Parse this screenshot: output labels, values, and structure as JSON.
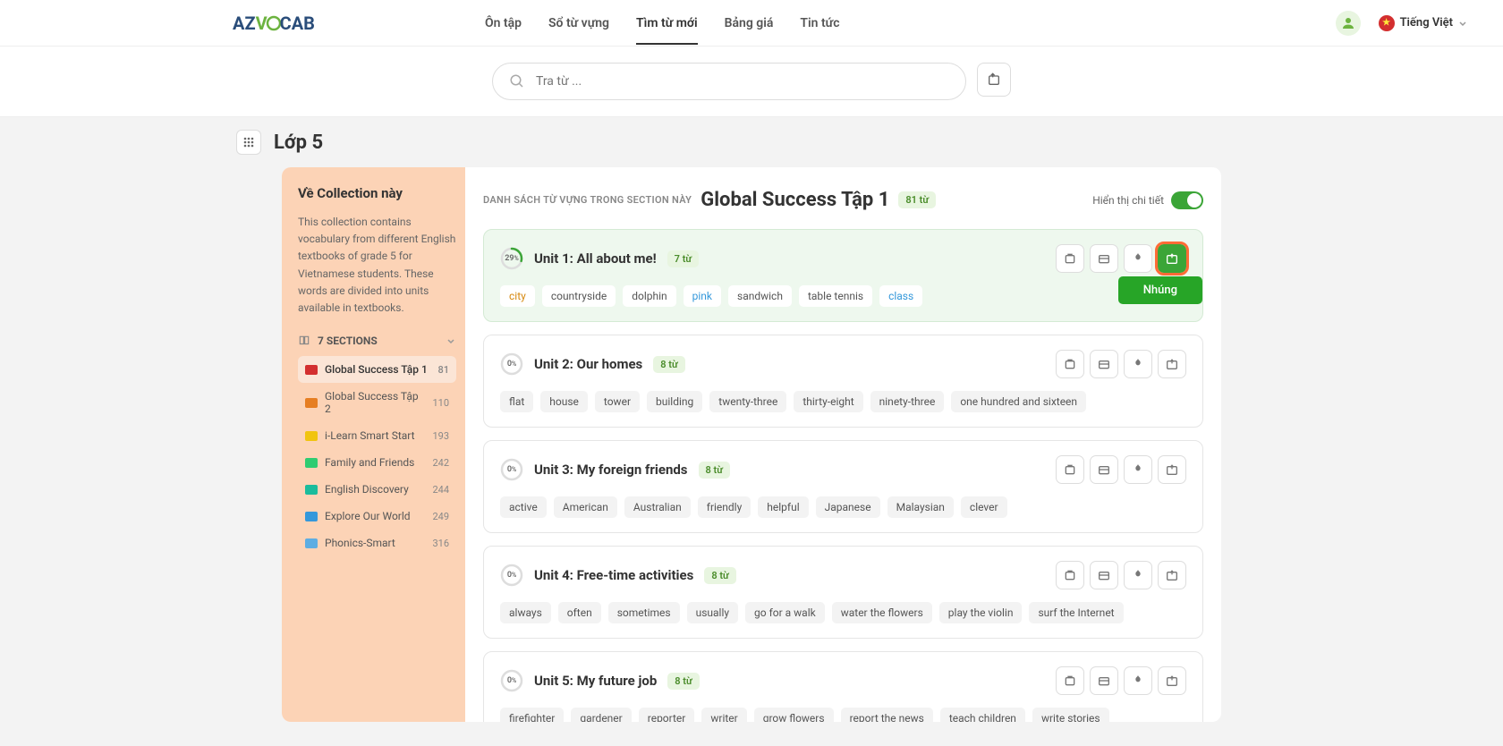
{
  "header": {
    "logo_az": "AZ",
    "logo_v": "V",
    "logo_ocab": "CAB",
    "nav": [
      "Ôn tập",
      "Sổ từ vựng",
      "Tìm từ mới",
      "Bảng giá",
      "Tin tức"
    ],
    "nav_active": 2,
    "lang_label": "Tiếng Việt"
  },
  "search": {
    "placeholder": "Tra từ ..."
  },
  "breadcrumb": "Lớp 5",
  "sidebar": {
    "title": "Về Collection này",
    "desc": "This collection contains vocabulary from different English textbooks of grade 5 for Vietnamese students. These words are divided into units available in textbooks.",
    "sections_label": "7 SECTIONS",
    "items": [
      {
        "name": "Global Success Tập 1",
        "count": "81",
        "color": "#d32f2f",
        "active": true
      },
      {
        "name": "Global Success Tập 2",
        "count": "110",
        "color": "#e67e22",
        "active": false
      },
      {
        "name": "i-Learn Smart Start",
        "count": "193",
        "color": "#f1c40f",
        "active": false
      },
      {
        "name": "Family and Friends",
        "count": "242",
        "color": "#2ecc71",
        "active": false
      },
      {
        "name": "English Discovery",
        "count": "244",
        "color": "#1abc9c",
        "active": false
      },
      {
        "name": "Explore Our World",
        "count": "249",
        "color": "#3498db",
        "active": false
      },
      {
        "name": "Phonics-Smart",
        "count": "316",
        "color": "#5dade2",
        "active": false
      }
    ]
  },
  "main": {
    "subtitle": "DANH SÁCH TỪ VỰNG TRONG SECTION NÀY",
    "title": "Global Success Tập 1",
    "badge": "81 từ",
    "toggle_label": "Hiển thị chi tiết",
    "tooltip": "Nhúng",
    "units": [
      {
        "progress": 29,
        "title": "Unit 1: All about me!",
        "count": "7 từ",
        "active": true,
        "tags": [
          {
            "t": "city",
            "c": "learned"
          },
          {
            "t": "countryside"
          },
          {
            "t": "dolphin"
          },
          {
            "t": "pink",
            "c": "blue"
          },
          {
            "t": "sandwich"
          },
          {
            "t": "table tennis"
          },
          {
            "t": "class",
            "c": "blue"
          }
        ]
      },
      {
        "progress": 0,
        "title": "Unit 2: Our homes",
        "count": "8 từ",
        "tags": [
          {
            "t": "flat"
          },
          {
            "t": "house"
          },
          {
            "t": "tower"
          },
          {
            "t": "building"
          },
          {
            "t": "twenty-three"
          },
          {
            "t": "thirty-eight"
          },
          {
            "t": "ninety-three"
          },
          {
            "t": "one hundred and sixteen"
          }
        ]
      },
      {
        "progress": 0,
        "title": "Unit 3: My foreign friends",
        "count": "8 từ",
        "tags": [
          {
            "t": "active"
          },
          {
            "t": "American"
          },
          {
            "t": "Australian"
          },
          {
            "t": "friendly"
          },
          {
            "t": "helpful"
          },
          {
            "t": "Japanese"
          },
          {
            "t": "Malaysian"
          },
          {
            "t": "clever"
          }
        ]
      },
      {
        "progress": 0,
        "title": "Unit 4: Free-time activities",
        "count": "8 từ",
        "tags": [
          {
            "t": "always"
          },
          {
            "t": "often"
          },
          {
            "t": "sometimes"
          },
          {
            "t": "usually"
          },
          {
            "t": "go for a walk"
          },
          {
            "t": "water the flowers"
          },
          {
            "t": "play the violin"
          },
          {
            "t": "surf the Internet"
          }
        ]
      },
      {
        "progress": 0,
        "title": "Unit 5: My future job",
        "count": "8 từ",
        "tags": [
          {
            "t": "firefighter"
          },
          {
            "t": "gardener"
          },
          {
            "t": "reporter"
          },
          {
            "t": "writer"
          },
          {
            "t": "grow flowers"
          },
          {
            "t": "report the news"
          },
          {
            "t": "teach children"
          },
          {
            "t": "write stories"
          }
        ]
      }
    ]
  }
}
